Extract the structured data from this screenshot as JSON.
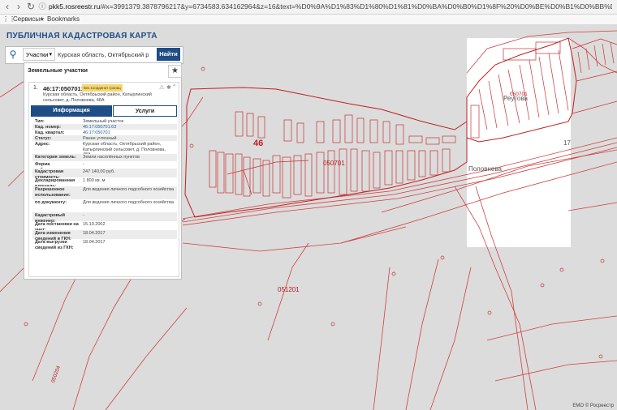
{
  "browser": {
    "url_domain": "pkk5.rosreestr.ru",
    "url_rest": "/#x=3991379.3878796217&y=6734583.634162964&z=16&text=%D0%9A%D1%83%D1%80%D1%81%D0%BA%D0%B0%D1%8F%20%D0%BE%D0%B1%D0%BB%D0%B0%D1%81%D1%82%D1%8C%2C%20%D0%9E",
    "bookmarks": [
      "Сервисы",
      "Bookmarks"
    ]
  },
  "site": {
    "title": "ПУБЛИЧНАЯ КАДАСТРОВАЯ КАРТА"
  },
  "search": {
    "type_label": "Участки",
    "query": "Курская область, Октябрьский р",
    "find_label": "Найти"
  },
  "panel": {
    "title": "Земельные участки",
    "row_number": "1.",
    "cad_number": "46:17:050701:63",
    "badge": "Без координат границ",
    "address_short": "Курская область, Октябрьский район, Катырлинский сельсовет, д. Половнева, 48А",
    "tabs": {
      "info": "Информация",
      "services": "Услуги"
    },
    "rows": [
      {
        "k": "Тип:",
        "v": "Земельный участок",
        "link": false
      },
      {
        "k": "Кад. номер:",
        "v": "46:17:050701:63",
        "link": true
      },
      {
        "k": "Кад. квартал:",
        "v": "46:17:050701",
        "link": true
      },
      {
        "k": "Статус:",
        "v": "Ранее учтенный",
        "link": false
      },
      {
        "k": "Адрес:",
        "v": "Курская область, Октябрьский район, Катырлинский сельсовет, д. Половнева, 48А",
        "link": false
      },
      {
        "k": "Категория земель:",
        "v": "Земли населённых пунктов",
        "link": false
      },
      {
        "k": "Форма собственности:",
        "v": "-",
        "link": false
      },
      {
        "k": "Кадастровая стоимость:",
        "v": "247 140,00 руб.",
        "link": false
      },
      {
        "k": "Декларированная площадь:",
        "v": "1 800 кв. м",
        "link": false
      },
      {
        "k": "Разрешенное использование:",
        "v": "Для ведения личного подсобного хозяйства",
        "link": false
      },
      {
        "k": "по документу:",
        "v": "Для ведения личного подсобного хозяйства",
        "link": false
      },
      {
        "k": "Кадастровый инженер:",
        "v": "-",
        "link": false
      },
      {
        "k": "Дата постановки на учет:",
        "v": "15.10.2002",
        "link": false
      },
      {
        "k": "Дата изменения сведений в ГКН:",
        "v": "18.04.2017",
        "link": false
      },
      {
        "k": "Дата выгрузки сведений из ГКН:",
        "v": "18.04.2017",
        "link": false
      }
    ]
  },
  "map": {
    "labels": {
      "quarter_46": "46",
      "block_1": "050701",
      "block_2": "051201",
      "village_1": "Реутова",
      "village_1_code": "050701",
      "village_2": "Половнева",
      "road": "17",
      "vertical_code": "050204"
    },
    "attribution": "EMO © Росреестр"
  }
}
